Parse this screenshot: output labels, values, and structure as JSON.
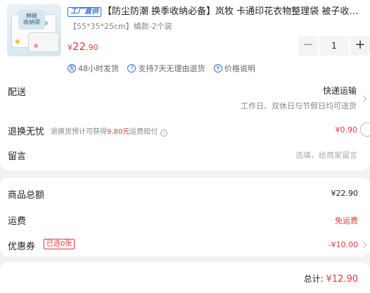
{
  "product": {
    "badge": "工厂直供",
    "title": "【防尘防潮 换季收纳必备】岚牧 卡通印花衣物整理袋 被子收纳袋",
    "spec": "【55*35*25cm】橘款-2个装",
    "thumb_text": "棉被\n收纳袋",
    "price_currency": "¥",
    "price_int": "22",
    "price_dec": ".90",
    "quantity": "1",
    "minus": "−",
    "plus": "+",
    "services": [
      {
        "icon": "发",
        "icon_name": "ship-48h-icon",
        "label": "48小时发货"
      },
      {
        "icon": "7",
        "icon_name": "return-7day-icon",
        "label": "支持7天无理由退货"
      },
      {
        "icon": "¥",
        "icon_name": "price-guarantee-icon",
        "label": "价格说明"
      }
    ]
  },
  "delivery": {
    "label": "配送",
    "type": "快递运输",
    "note": "工作日、双休日与节假日均可送货"
  },
  "return_worry": {
    "label": "退换无忧",
    "desc_prefix": "退换货预计可获得",
    "desc_amount": "9.80元",
    "desc_suffix": "运费赔付",
    "price": "¥0.90"
  },
  "message": {
    "label": "留言",
    "placeholder": "选填，给商家留言"
  },
  "summary": {
    "goods_label": "商品总额",
    "goods_value": "¥22.90",
    "shipping_label": "运费",
    "shipping_value": "免运费",
    "coupon_label": "优惠券",
    "coupon_tag": "已选0张",
    "coupon_value": "-¥10.00",
    "total_label": "总计:",
    "total_value": "¥12.90"
  },
  "colors": {
    "accent_red": "#e4393c",
    "badge_blue": "#3b6fd8"
  }
}
